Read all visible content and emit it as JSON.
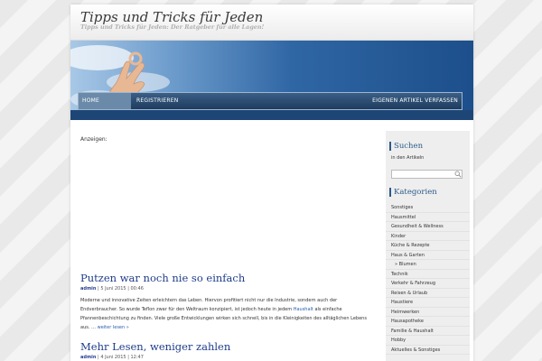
{
  "site": {
    "title": "Tipps und Tricks für Jeden",
    "description": "Tipps und Tricks für Jeden: Der Ratgeber für alle Lagen!"
  },
  "nav": {
    "home": "HOME",
    "register": "REGISTRIEREN",
    "write": "EIGENEN ARTIKEL VERFASSEN"
  },
  "main": {
    "ad_label": "Anzeigen:",
    "posts": [
      {
        "title": "Putzen war noch nie so einfach",
        "author": "admin",
        "date": "5 Juni 2015",
        "time": "00:46",
        "body_before": "Moderne und innovative Zeiten erleichtern das Leben. Hiervon profitiert nicht nur die Industrie, sondern auch der Endverbraucher. So wurde Teflon zwar für den Weltraum konzipiert, ist jedoch heute in jedem ",
        "body_link": "Haushalt",
        "body_after": " als einfache Pfannenbeschichtung zu finden. Viele große Entwicklungen wirken sich schnell, bis in die Kleinigkeiten des alltäglichen Lebens aus. …",
        "read_more": "weiter lesen »"
      },
      {
        "title": "Mehr Lesen, weniger zahlen",
        "author": "admin",
        "date": "4 Juni 2015",
        "time": "12:47"
      }
    ]
  },
  "sidebar": {
    "search": {
      "title": "Suchen",
      "subtitle": "in den Artikeln",
      "placeholder": ""
    },
    "categories": {
      "title": "Kategorien",
      "items": [
        {
          "label": "Sonstiges"
        },
        {
          "label": "Hausmittel"
        },
        {
          "label": "Gesundheit & Wellness"
        },
        {
          "label": "Kinder"
        },
        {
          "label": "Küche & Rezepte"
        },
        {
          "label": "Haus & Garten"
        },
        {
          "label": "» Blumen"
        },
        {
          "label": "Technik"
        },
        {
          "label": "Verkehr & Fahrzeug"
        },
        {
          "label": "Reisen & Urlaub"
        },
        {
          "label": "Haustiere"
        },
        {
          "label": "Heimwerken"
        },
        {
          "label": "Hausapotheke"
        },
        {
          "label": "Familie & Haushalt"
        },
        {
          "label": "Hobby"
        },
        {
          "label": "Aktuelles & Sonstiges"
        }
      ]
    }
  },
  "colors": {
    "accent": "#1f3d8a",
    "nav_bg": "#1e3c5e",
    "link": "#2a5fb0"
  }
}
